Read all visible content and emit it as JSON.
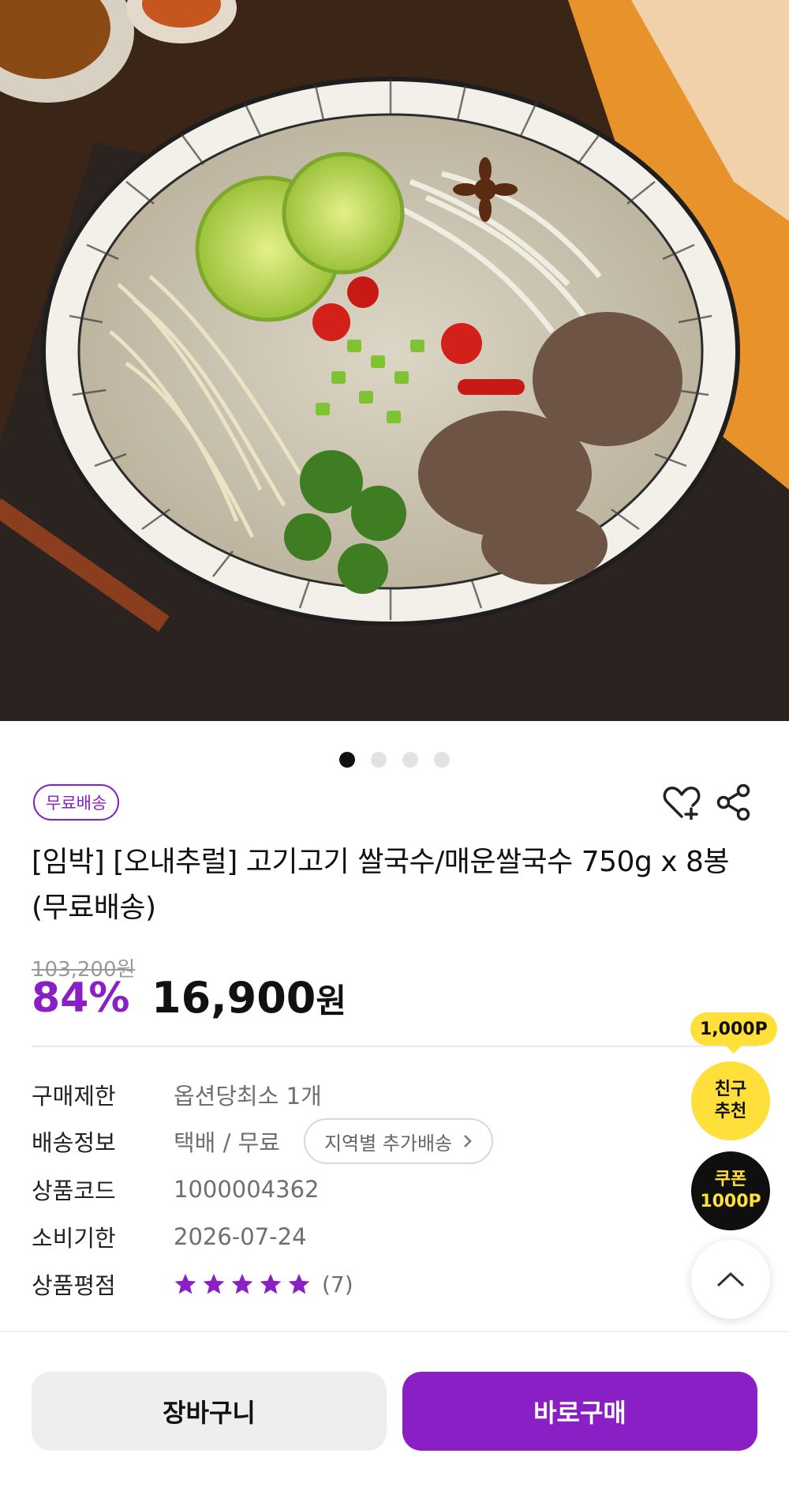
{
  "badge": "무료배송",
  "product": {
    "title": "[임박] [오내추럴] 고기고기 쌀국수/매운쌀국수 750g x 8봉 (무료배송)",
    "original_price": "103,200원",
    "discount": "84%",
    "price": "16,900",
    "price_unit": "원"
  },
  "gallery": {
    "total_images": 4,
    "current_index": 1
  },
  "info": {
    "purchase_limit": {
      "label": "구매제한",
      "value": "옵션당최소 1개"
    },
    "shipping": {
      "label": "배송정보",
      "value": "택배 / 무료",
      "region_button": "지역별 추가배송"
    },
    "product_code": {
      "label": "상품코드",
      "value": "1000004362"
    },
    "expiry": {
      "label": "소비기한",
      "value": "2026-07-24"
    },
    "rating": {
      "label": "상품평점",
      "stars": 5,
      "count": "(7)"
    }
  },
  "floating": {
    "points_badge": "1,000P",
    "friend_line1": "친구",
    "friend_line2": "추천",
    "coupon_line1": "쿠폰",
    "coupon_line2": "1000P"
  },
  "actions": {
    "cart": "장바구니",
    "buy": "바로구매"
  },
  "colors": {
    "accent": "#8a1fc6",
    "yellow": "#ffe03a",
    "dark": "#0f0f0f"
  }
}
